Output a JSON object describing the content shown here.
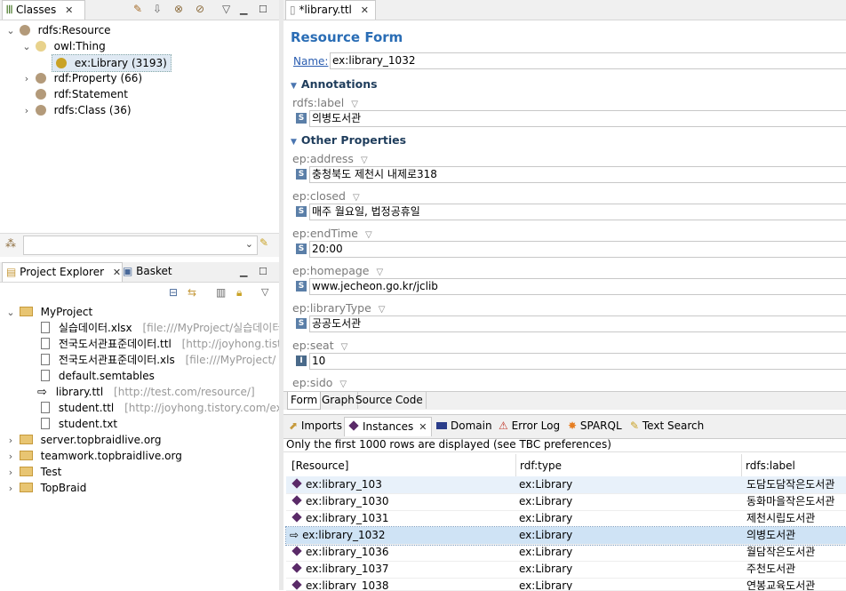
{
  "classes_panel": {
    "tab_label": "Classes",
    "tree": [
      {
        "label": "rdfs:Resource",
        "count": ""
      },
      {
        "label": "owl:Thing",
        "count": ""
      },
      {
        "label": "ex:Library",
        "count": "(3193)"
      },
      {
        "label": "rdf:Property",
        "count": "(66)"
      },
      {
        "label": "rdf:Statement",
        "count": ""
      },
      {
        "label": "rdfs:Class",
        "count": "(36)"
      }
    ]
  },
  "explorer_panel": {
    "tab_label": "Project Explorer",
    "basket_label": "Basket",
    "tree": [
      {
        "label": "MyProject",
        "hint": ""
      },
      {
        "label": "실습데이터.xlsx",
        "hint": "[file:///MyProject/실습데이터"
      },
      {
        "label": "전국도서관표준데이터.ttl",
        "hint": "[http://joyhong.tist"
      },
      {
        "label": "전국도서관표준데이터.xls",
        "hint": "[file:///MyProject/"
      },
      {
        "label": "default.semtables",
        "hint": ""
      },
      {
        "label": "library.ttl",
        "hint": "[http://test.com/resource/]"
      },
      {
        "label": "student.ttl",
        "hint": "[http://joyhong.tistory.com/exam"
      },
      {
        "label": "student.txt",
        "hint": ""
      },
      {
        "label": "server.topbraidlive.org",
        "hint": ""
      },
      {
        "label": "teamwork.topbraidlive.org",
        "hint": ""
      },
      {
        "label": "Test",
        "hint": ""
      },
      {
        "label": "TopBraid",
        "hint": ""
      }
    ]
  },
  "editor": {
    "tab_label": "*library.ttl",
    "form_title": "Resource Form",
    "name_label": "Name:",
    "name_value": "ex:library_1032",
    "annotations_label": "Annotations",
    "other_props_label": "Other Properties",
    "properties": [
      {
        "name": "rdfs:label",
        "type": "S",
        "value": "의병도서관"
      },
      {
        "name": "ep:address",
        "type": "S",
        "value": "충청북도 제천시 내제로318"
      },
      {
        "name": "ep:closed",
        "type": "S",
        "value": "매주 월요일, 법정공휴일"
      },
      {
        "name": "ep:endTime",
        "type": "S",
        "value": "20:00"
      },
      {
        "name": "ep:homepage",
        "type": "S",
        "value": "www.jecheon.go.kr/jclib"
      },
      {
        "name": "ep:libraryType",
        "type": "S",
        "value": "공공도서관"
      },
      {
        "name": "ep:seat",
        "type": "I",
        "value": "10"
      },
      {
        "name": "ep:sido",
        "type": "",
        "value": ""
      }
    ],
    "bottom_tabs": [
      "Form",
      "Graph",
      "Source Code"
    ]
  },
  "bottom_panel": {
    "tabs": [
      "Imports",
      "Instances",
      "Domain",
      "Error Log",
      "SPARQL",
      "Text Search"
    ],
    "info": "Only the first 1000 rows are displayed (see TBC preferences)",
    "columns": [
      "[Resource]",
      "rdf:type",
      "rdfs:label"
    ],
    "rows": [
      {
        "resource": "ex:library_103",
        "type": "ex:Library",
        "label": "도담도담작은도서관"
      },
      {
        "resource": "ex:library_1030",
        "type": "ex:Library",
        "label": "동화마을작은도서관"
      },
      {
        "resource": "ex:library_1031",
        "type": "ex:Library",
        "label": "제천시립도서관"
      },
      {
        "resource": "ex:library_1032",
        "type": "ex:Library",
        "label": "의병도서관"
      },
      {
        "resource": "ex:library_1036",
        "type": "ex:Library",
        "label": "월담작은도서관"
      },
      {
        "resource": "ex:library_1037",
        "type": "ex:Library",
        "label": "주천도서관"
      },
      {
        "resource": "ex:library_1038",
        "type": "ex:Library",
        "label": "연봉교육도서관"
      }
    ]
  }
}
